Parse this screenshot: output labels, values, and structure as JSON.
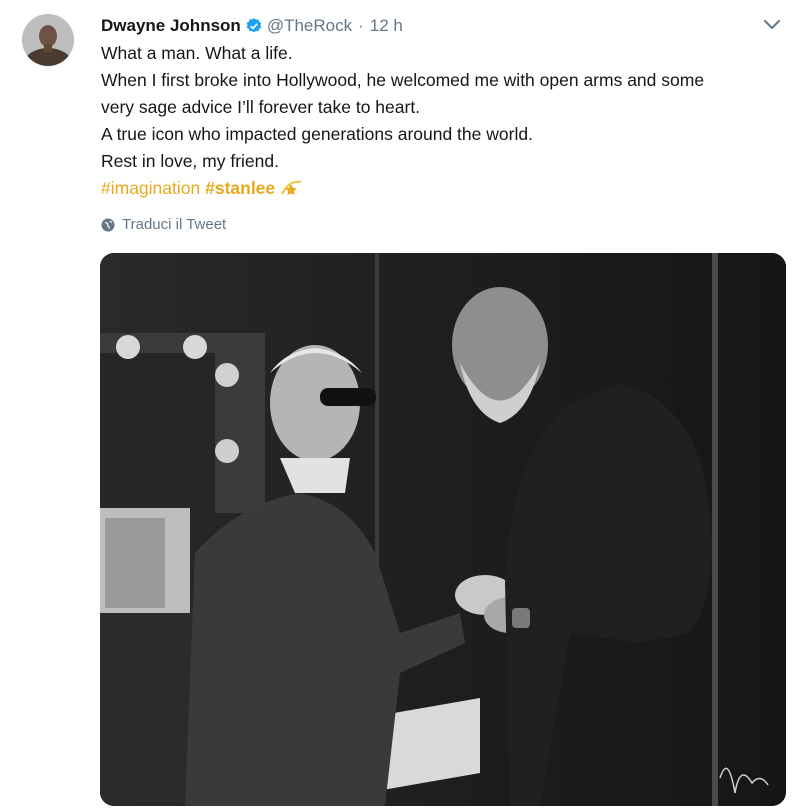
{
  "tweet": {
    "author_name": "Dwayne Johnson",
    "handle": "@TheRock",
    "separator": "·",
    "time": "12 h",
    "lines": [
      "What a man. What a life.",
      "When I first broke into Hollywood, he welcomed me with open arms and some",
      "very sage advice I’ll forever take to heart.",
      "A true icon who impacted generations around the world.",
      "Rest in love, my friend."
    ],
    "hashtag_1": "#imagination",
    "hashtag_2": "#stanlee",
    "hashtag_emoji": "star-hashflag-icon",
    "translate_label": "Traduci il Tweet",
    "colors": {
      "hashtag": "#e8a91c",
      "verified": "#1da1f2",
      "secondary_text": "#657786"
    },
    "icons": [
      "verified-badge-icon",
      "chevron-down-icon",
      "globe-icon"
    ]
  }
}
